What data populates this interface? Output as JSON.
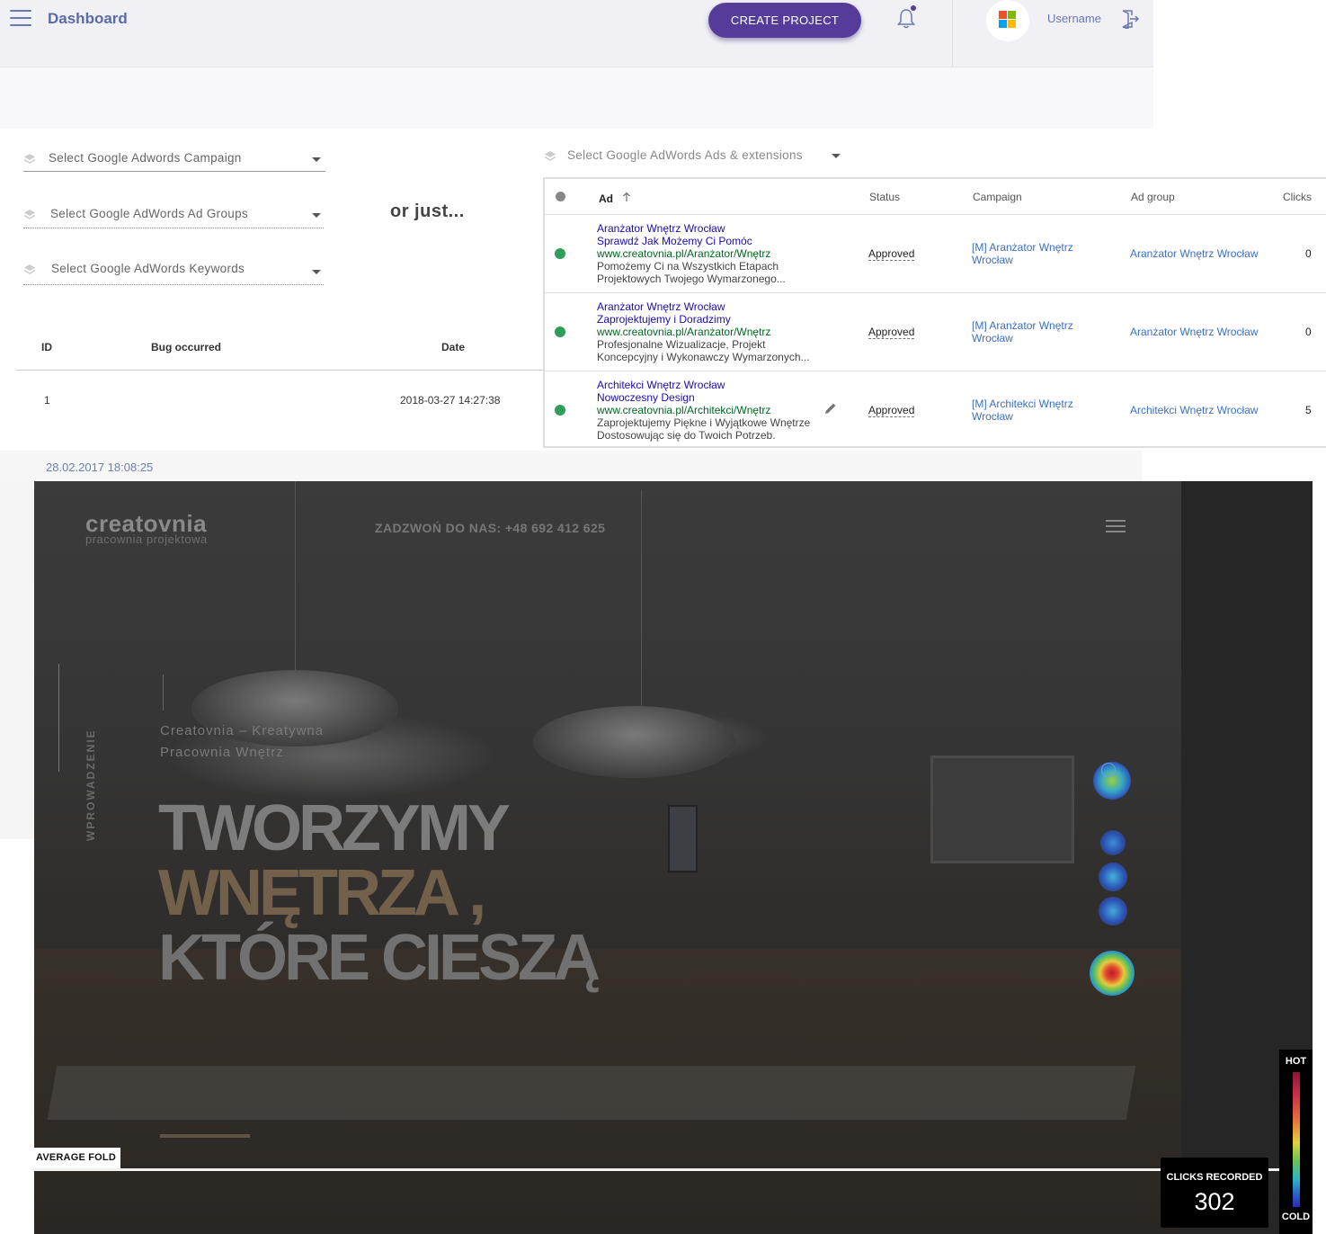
{
  "topbar": {
    "title": "Dashboard",
    "create_button": "CREATE PROJECT",
    "username": "Username"
  },
  "selects": {
    "campaign": "Select Google Adwords Campaign",
    "ad_groups": "Select Google AdWords Ad Groups",
    "keywords": "Select Google AdWords Keywords",
    "ads_extensions": "Select Google AdWords Ads & extensions"
  },
  "or_just": "or just...",
  "bug_table": {
    "columns": [
      "ID",
      "Bug occurred",
      "Date"
    ],
    "rows": [
      {
        "id": "1",
        "bug": "",
        "date": "2018-03-27 14:27:38"
      }
    ]
  },
  "ads_table": {
    "columns": {
      "ad": "Ad",
      "status": "Status",
      "campaign": "Campaign",
      "ad_group": "Ad group",
      "clicks": "Clicks"
    },
    "rows": [
      {
        "title1": "Aranżator Wnętrz Wrocław",
        "title2": "Sprawdź Jak Możemy Ci Pomóc",
        "url": "www.creatovnia.pl/Aranżator/Wnętrz",
        "desc1": "Pomożemy Ci na Wszystkich Etapach",
        "desc2": "Projektowych Twojego Wymarzonego...",
        "status": "Approved",
        "campaign_line1": "[M] Aranżator Wnętrz",
        "campaign_line2": "Wrocław",
        "ad_group": "Aranżator Wnętrz Wrocław",
        "clicks": "0"
      },
      {
        "title1": "Aranżator Wnętrz Wrocław",
        "title2": "Zaprojektujemy i Doradzimy",
        "url": "www.creatovnia.pl/Aranżator/Wnętrz",
        "desc1": "Profesjonalne Wizualizacje, Projekt",
        "desc2": "Koncepcyjny i Wykonawczy Wymarzonych...",
        "status": "Approved",
        "campaign_line1": "[M] Aranżator Wnętrz",
        "campaign_line2": "Wrocław",
        "ad_group": "Aranżator Wnętrz Wrocław",
        "clicks": "0"
      },
      {
        "title1": "Architekci Wnętrz Wrocław",
        "title2": "Nowoczesny Design",
        "url": "www.creatovnia.pl/Architekci/Wnętrz",
        "desc1": "Zaprojektujemy Piękne i Wyjątkowe Wnętrze",
        "desc2": "Dostosowując się do Twoich Potrzeb.",
        "status": "Approved",
        "campaign_line1": "[M] Architekci Wnętrz",
        "campaign_line2": "Wrocław",
        "ad_group": "Architekci Wnętrz Wrocław",
        "clicks": "5"
      }
    ]
  },
  "heatmap": {
    "timestamp": "28.02.2017 18:08:25",
    "site": {
      "logo": "creatovnia",
      "logo_sub": "pracownia projektowa",
      "phone": "ZADZWOŃ DO NAS: +48 692 412 625",
      "vertical_label": "WPROWADZENIE",
      "tagline1": "Creatovnia – Kreatywna",
      "tagline2": "Pracownia Wnętrz",
      "headline1": "TWORZYMY",
      "headline2": "WNĘTRZA ,",
      "headline3": "KTÓRE CIESZĄ"
    },
    "average_fold": "AVERAGE FOLD",
    "legend_hot": "HOT",
    "legend_cold": "COLD",
    "clicks_label": "CLICKS RECORDED",
    "clicks_count": "302"
  },
  "colors": {
    "brand_purple": "#553c9a",
    "link_blue": "#3a6fc4",
    "ad_title": "#1a0dab",
    "ad_url": "#006621",
    "status_green": "#2e9e5a"
  }
}
